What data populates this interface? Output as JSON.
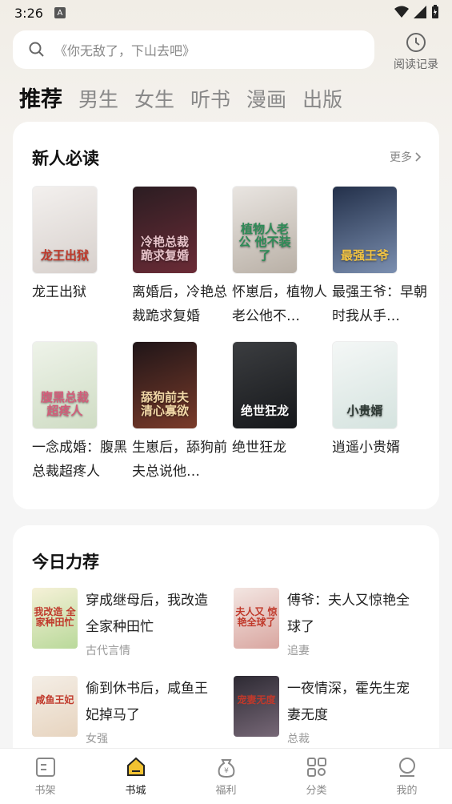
{
  "status": {
    "time": "3:26",
    "indicator": "A"
  },
  "search": {
    "placeholder": "《你无敌了，下山去吧》"
  },
  "history": {
    "label": "阅读记录"
  },
  "tabs": [
    "推荐",
    "男生",
    "女生",
    "听书",
    "漫画",
    "出版"
  ],
  "section1": {
    "title": "新人必读",
    "more": "更多",
    "books": [
      {
        "title": "龙王出狱",
        "cover_text": "龙王出狱",
        "colors": [
          "#f3f0ee",
          "#d7d0cc"
        ],
        "text_color": "#c0392b"
      },
      {
        "title": "离婚后，冷艳总裁跪求复婚",
        "cover_text": "冷艳总裁 跪求复婚",
        "colors": [
          "#2b1d22",
          "#6b2b36"
        ],
        "text_color": "#e7c2c9"
      },
      {
        "title": "怀崽后，植物人老公他不…",
        "cover_text": "植物人老公 他不装了",
        "colors": [
          "#e9e5e1",
          "#b9b0a6"
        ],
        "text_color": "#2e8b57"
      },
      {
        "title": "最强王爷：早朝时我从手…",
        "cover_text": "最强王爷",
        "colors": [
          "#23304a",
          "#7b8fb0"
        ],
        "text_color": "#f4c542"
      },
      {
        "title": "一念成婚：腹黑总裁超疼人",
        "cover_text": "腹黑总裁 超疼人",
        "colors": [
          "#eef3e9",
          "#cfdcc4"
        ],
        "text_color": "#d35d7a"
      },
      {
        "title": "生崽后，舔狗前夫总说他…",
        "cover_text": "舔狗前夫 清心寡欲",
        "colors": [
          "#1f1518",
          "#7a3b2a"
        ],
        "text_color": "#f1d7a6"
      },
      {
        "title": "绝世狂龙",
        "cover_text": "绝世狂龙",
        "colors": [
          "#3b3d40",
          "#16181b"
        ],
        "text_color": "#ffffff"
      },
      {
        "title": "逍遥小贵婿",
        "cover_text": "小贵婿",
        "colors": [
          "#f4f7f6",
          "#d5e3df"
        ],
        "text_color": "#2f3b36"
      }
    ]
  },
  "section2": {
    "title": "今日力荐",
    "items": [
      {
        "title": "穿成继母后，我改造全家种田忙",
        "tag": "古代言情",
        "cover_text": "我改造 全家种田忙",
        "colors": [
          "#f6f1d8",
          "#b9d99a"
        ]
      },
      {
        "title": "傅爷：夫人又惊艳全球了",
        "tag": "追妻",
        "cover_text": "夫人又 惊艳全球了",
        "colors": [
          "#f3e6e2",
          "#d9a6a0"
        ]
      },
      {
        "title": "偷到休书后，咸鱼王妃掉马了",
        "tag": "女强",
        "cover_text": "咸鱼王妃",
        "colors": [
          "#f4eee6",
          "#e7d4bf"
        ]
      },
      {
        "title": "一夜情深，霍先生宠妻无度",
        "tag": "总裁",
        "cover_text": "宠妻无度",
        "colors": [
          "#2d2a33",
          "#776877"
        ]
      }
    ]
  },
  "nav": [
    {
      "label": "书架",
      "icon": "bookshelf-icon"
    },
    {
      "label": "书城",
      "icon": "bookstore-icon"
    },
    {
      "label": "福利",
      "icon": "coin-bag-icon"
    },
    {
      "label": "分类",
      "icon": "category-grid-icon"
    },
    {
      "label": "我的",
      "icon": "profile-icon"
    }
  ],
  "active_nav": "书城",
  "colors": {
    "accent": "#f2c230",
    "background": "#f5f5f5",
    "card": "#ffffff"
  }
}
